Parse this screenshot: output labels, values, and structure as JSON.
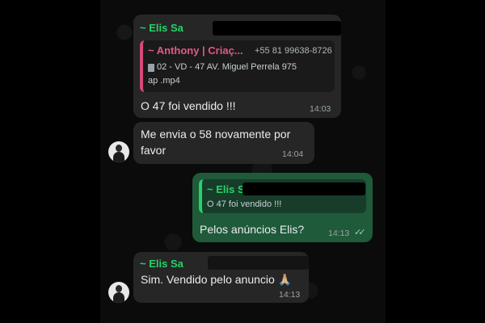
{
  "messages": [
    {
      "sender": "~ Elis Sa",
      "quote": {
        "sender": "~ Anthony | Criaç...",
        "phone": "+55 81 99638-8726",
        "line1": "02 - VD - 47 AV. Miguel Perrela 975",
        "line2": "ap .mp4"
      },
      "text": "O 47 foi vendido !!!",
      "time": "14:03"
    },
    {
      "text_line1": "Me envia o 58 novamente por",
      "text_line2": "favor",
      "time": "14:04"
    },
    {
      "quote": {
        "sender": "~ Elis S",
        "text": "O 47 foi vendido !!!"
      },
      "text": "Pelos anúncios Elis?",
      "time": "14:13"
    },
    {
      "sender": "~ Elis Sa",
      "text": "Sim. Vendido pelo anuncio 🙏🏼",
      "time": "14:13"
    }
  ],
  "icons": {
    "document": "document-icon",
    "read_ticks": "double-check-icon",
    "avatar": "contact-avatar"
  },
  "colors": {
    "incoming_bubble": "#262626",
    "outgoing_bubble": "#1f5a3a",
    "sender_green": "#25d366",
    "quote_pink": "#d64a77"
  }
}
